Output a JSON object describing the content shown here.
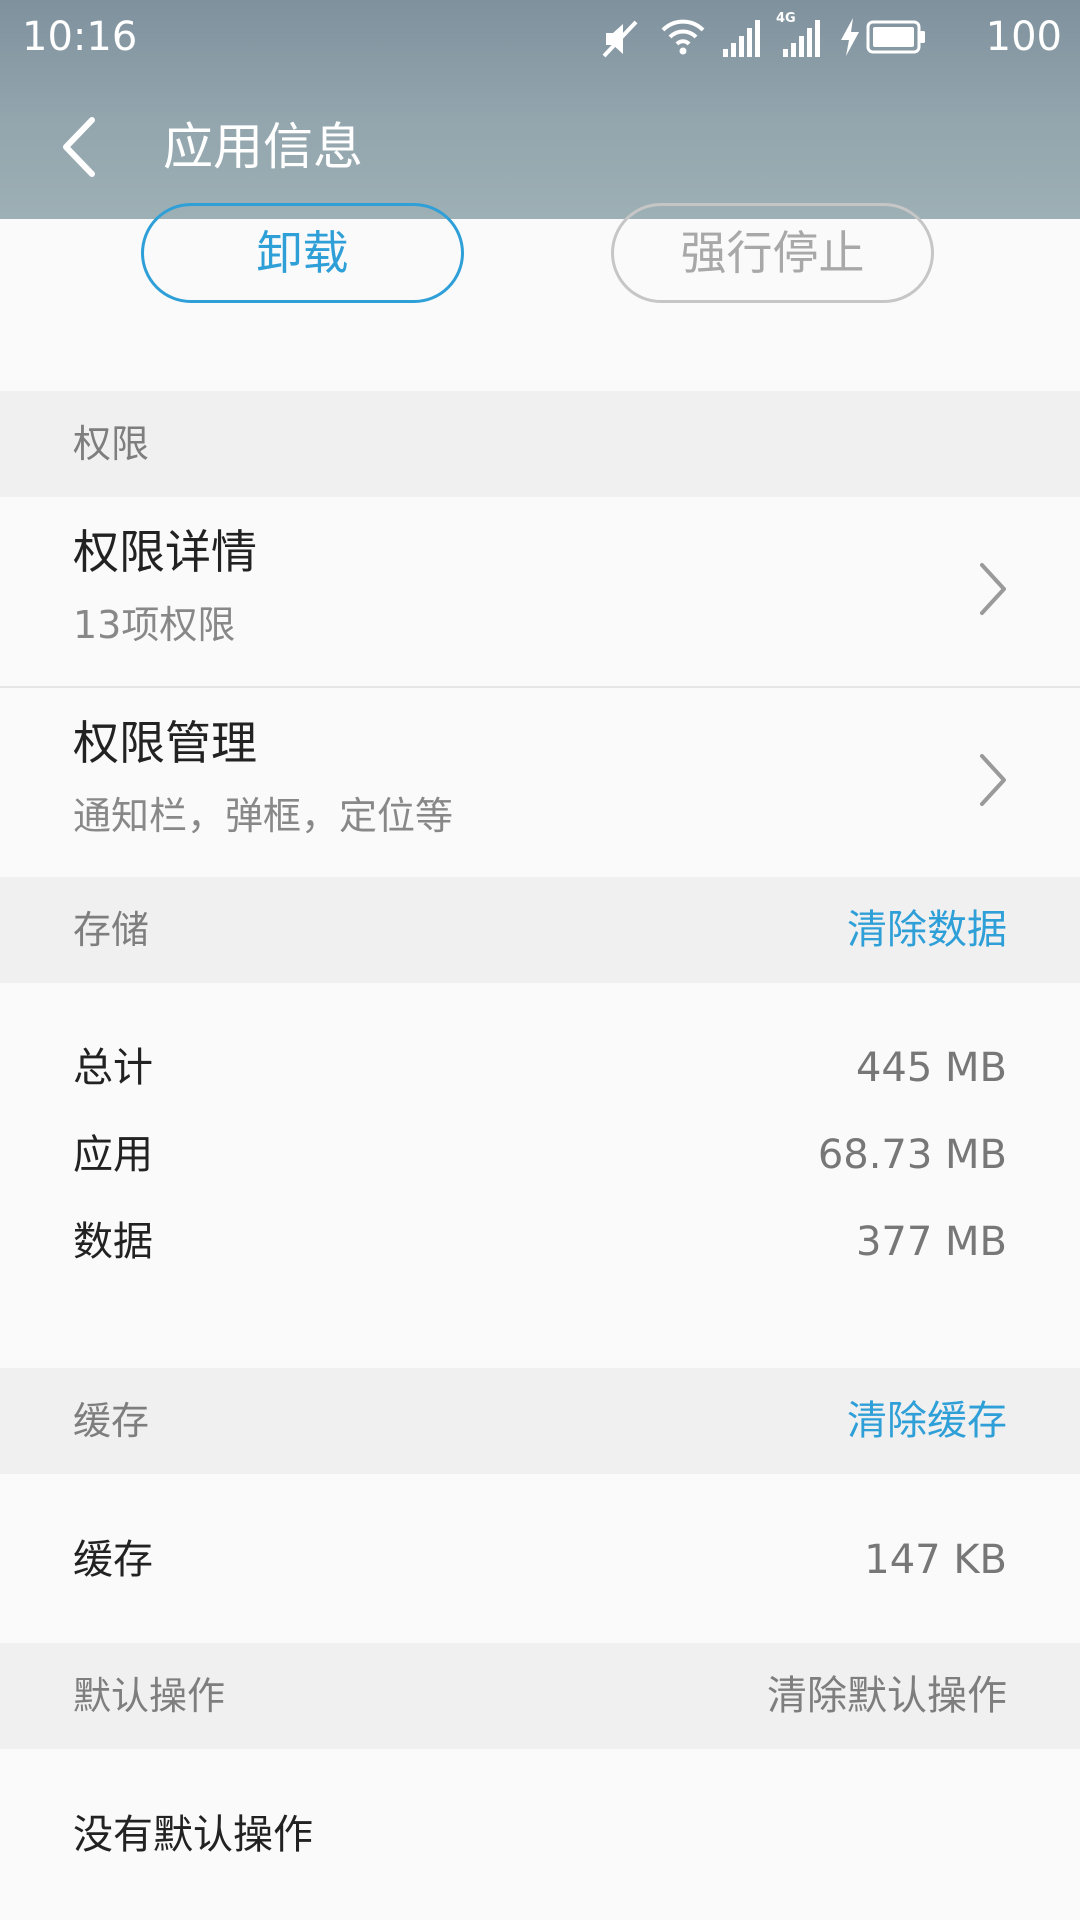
{
  "status_bar": {
    "time": "10:16",
    "battery_level": "100",
    "network_type": "4G",
    "icons": [
      "mute-icon",
      "wifi-icon",
      "signal-icon",
      "signal-4g-icon",
      "charging-icon",
      "battery-icon"
    ]
  },
  "toolbar": {
    "title": "应用信息",
    "back_icon": "back-arrow-icon"
  },
  "actions": {
    "uninstall_label": "卸载",
    "force_stop_label": "强行停止"
  },
  "permissions": {
    "header": "权限",
    "details_title": "权限详情",
    "details_subtitle": "13项权限",
    "manage_title": "权限管理",
    "manage_subtitle": "通知栏，弹框，定位等"
  },
  "storage": {
    "header": "存储",
    "clear_label": "清除数据",
    "rows": [
      {
        "label": "总计",
        "value": "445 MB"
      },
      {
        "label": "应用",
        "value": "68.73 MB"
      },
      {
        "label": "数据",
        "value": "377 MB"
      }
    ]
  },
  "cache": {
    "header": "缓存",
    "clear_label": "清除缓存",
    "label": "缓存",
    "value": "147 KB"
  },
  "defaults": {
    "header": "默认操作",
    "clear_label": "清除默认操作",
    "empty_text": "没有默认操作"
  },
  "colors": {
    "accent": "#2f9fd8",
    "appbar": "#8fa1aa",
    "section_bg": "#f0f0f0",
    "disabled": "#a8a8a8"
  }
}
